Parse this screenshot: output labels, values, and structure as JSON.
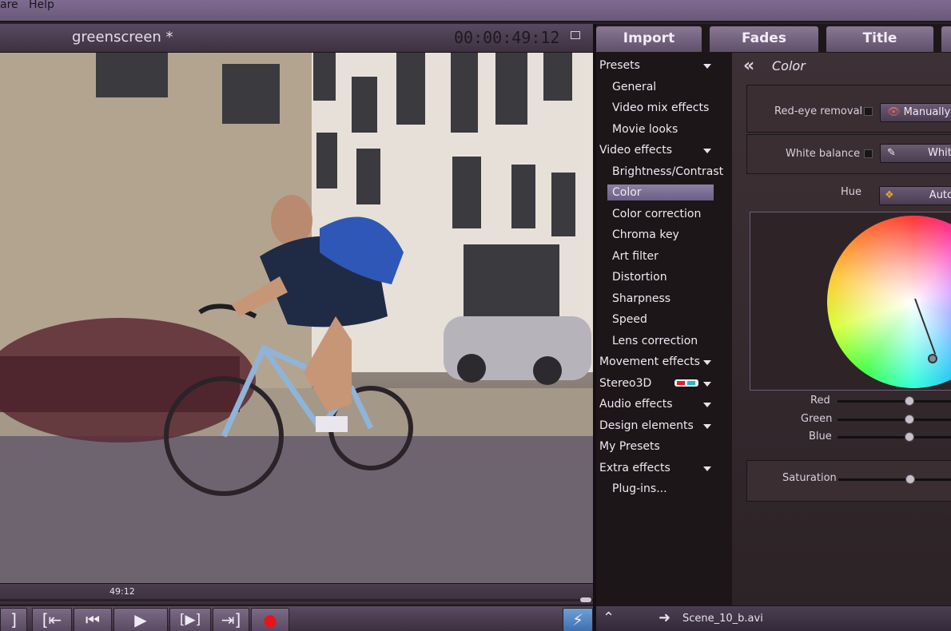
{
  "menu": [
    "are",
    "Help"
  ],
  "preview": {
    "title": "greenscreen *",
    "timecode": "00:00:49:12",
    "scrub_time": "49:12",
    "position_fraction": 0.985
  },
  "transport": {
    "buttons": [
      {
        "name": "mark-out-button",
        "glyph": "]"
      },
      {
        "name": "go-to-start-button",
        "glyph": "[⇤"
      },
      {
        "name": "previous-frame-button",
        "glyph": "⏮"
      },
      {
        "name": "play-button",
        "glyph": "▶"
      },
      {
        "name": "next-frame-button",
        "glyph": "[▶]"
      },
      {
        "name": "go-to-end-button",
        "glyph": "⇥]"
      },
      {
        "name": "record-button",
        "glyph": "●"
      },
      {
        "name": "lightning-button",
        "glyph": "⚡"
      }
    ]
  },
  "tabs": [
    "Import",
    "Fades",
    "Title"
  ],
  "fx": [
    {
      "label": "Presets",
      "level": "top",
      "caret": true
    },
    {
      "label": "General",
      "level": "sub"
    },
    {
      "label": "Video mix effects",
      "level": "sub"
    },
    {
      "label": "Movie looks",
      "level": "sub"
    },
    {
      "label": "Video effects",
      "level": "top",
      "caret": true
    },
    {
      "label": "Brightness/Contrast",
      "level": "sub"
    },
    {
      "label": "Color",
      "level": "sub",
      "selected": true
    },
    {
      "label": "Color correction",
      "level": "sub"
    },
    {
      "label": "Chroma key",
      "level": "sub"
    },
    {
      "label": "Art filter",
      "level": "sub"
    },
    {
      "label": "Distortion",
      "level": "sub"
    },
    {
      "label": "Sharpness",
      "level": "sub"
    },
    {
      "label": "Speed",
      "level": "sub"
    },
    {
      "label": "Lens correction",
      "level": "sub"
    },
    {
      "label": "Movement effects",
      "level": "top",
      "caret": true
    },
    {
      "label": "Stereo3D",
      "level": "top",
      "caret": true,
      "badge": true
    },
    {
      "label": "Audio effects",
      "level": "top",
      "caret": true
    },
    {
      "label": "Design elements",
      "level": "top",
      "caret": true
    },
    {
      "label": "My Presets",
      "level": "top"
    },
    {
      "label": "Extra effects",
      "level": "top",
      "caret": true
    },
    {
      "label": "Plug-ins...",
      "level": "sub"
    }
  ],
  "color_panel": {
    "title": "Color",
    "red_eye_label": "Red-eye removal",
    "red_eye_button": "Manually",
    "white_balance_label": "White balance",
    "white_balance_button": "White",
    "hue_label": "Hue",
    "hue_button": "Auto",
    "sliders": [
      {
        "label": "Red",
        "value": 0.6
      },
      {
        "label": "Green",
        "value": 0.6
      },
      {
        "label": "Blue",
        "value": 0.6
      }
    ],
    "saturation_label": "Saturation",
    "saturation_value": 0.6
  },
  "status": {
    "file": "Scene_10_b.avi"
  }
}
